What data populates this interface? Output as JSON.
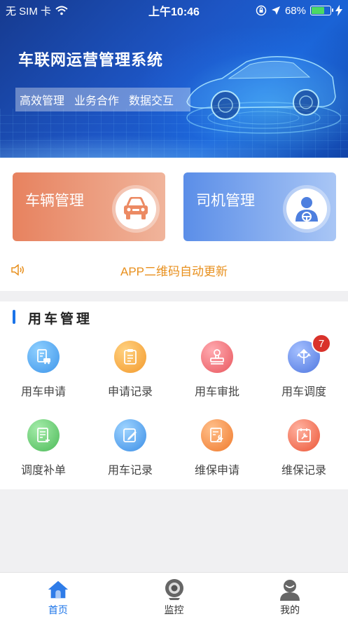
{
  "status_bar": {
    "carrier": "无 SIM 卡",
    "time": "上午10:46",
    "battery": "68%",
    "battery_level": 0.68,
    "icons": [
      "wifi-icon",
      "orientation-lock-icon",
      "location-arrow-icon",
      "battery-icon",
      "charging-icon"
    ]
  },
  "banner": {
    "title": "车联网运营管理系统",
    "tags": [
      "高效管理",
      "业务合作",
      "数据交互"
    ]
  },
  "cards": {
    "vehicle": {
      "label": "车辆管理",
      "icon": "car-icon",
      "color_from": "#e7825f",
      "color_to": "#f0b49b"
    },
    "driver": {
      "label": "司机管理",
      "icon": "driver-icon",
      "color_from": "#5b8ee8",
      "color_to": "#a9c6f5"
    }
  },
  "notice": {
    "text": "APP二维码自动更新",
    "icon": "speaker-icon",
    "color": "#e8901e"
  },
  "section": {
    "title": "用车管理",
    "items": [
      {
        "label": "用车申请",
        "icon": "car-apply-icon",
        "color": "#4aa6f0"
      },
      {
        "label": "申请记录",
        "icon": "clipboard-icon",
        "color": "#f4a73c"
      },
      {
        "label": "用车审批",
        "icon": "stamp-icon",
        "color": "#ef6f73"
      },
      {
        "label": "用车调度",
        "icon": "dispatch-arrows-icon",
        "color": "#5e88e8",
        "badge": "7"
      },
      {
        "label": "调度补单",
        "icon": "add-document-icon",
        "color": "#5cc96a"
      },
      {
        "label": "用车记录",
        "icon": "edit-note-icon",
        "color": "#4aa6f0"
      },
      {
        "label": "维保申请",
        "icon": "wrench-document-icon",
        "color": "#f38d45"
      },
      {
        "label": "维保记录",
        "icon": "maintenance-calendar-icon",
        "color": "#f0684f"
      }
    ]
  },
  "tabbar": {
    "active_color": "#1a73e8",
    "tabs": [
      {
        "label": "首页",
        "icon": "home-icon",
        "active": true
      },
      {
        "label": "监控",
        "icon": "camera-icon",
        "active": false
      },
      {
        "label": "我的",
        "icon": "user-icon",
        "active": false
      }
    ]
  }
}
